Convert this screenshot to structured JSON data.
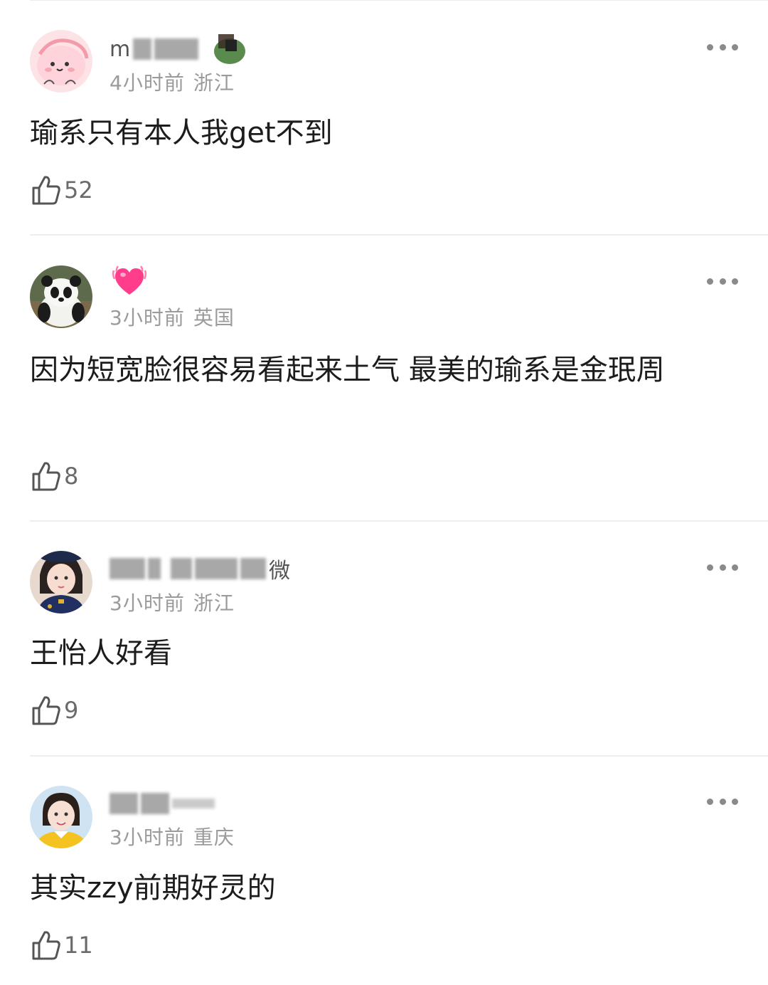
{
  "comments": [
    {
      "username": "m",
      "time": "4小时前",
      "location": "浙江",
      "text": "瑜系只有本人我get不到",
      "likes": "52"
    },
    {
      "username": "",
      "time": "3小时前",
      "location": "英国",
      "text": "因为短宽脸很容易看起来土气 最美的瑜系是金珉周",
      "likes": "8"
    },
    {
      "username": "微",
      "time": "3小时前",
      "location": "浙江",
      "text": "王怡人好看",
      "likes": "9"
    },
    {
      "username": "",
      "time": "3小时前",
      "location": "重庆",
      "text": "其实zzy前期好灵的",
      "likes": "11"
    }
  ],
  "icons": {
    "like": "thumbs-up-icon",
    "more": "more-dots-icon",
    "badge": "heart-icon"
  },
  "colors": {
    "meta": "#9b9b9b",
    "divider": "#eeeeee",
    "heart": "#ff3d8b"
  }
}
